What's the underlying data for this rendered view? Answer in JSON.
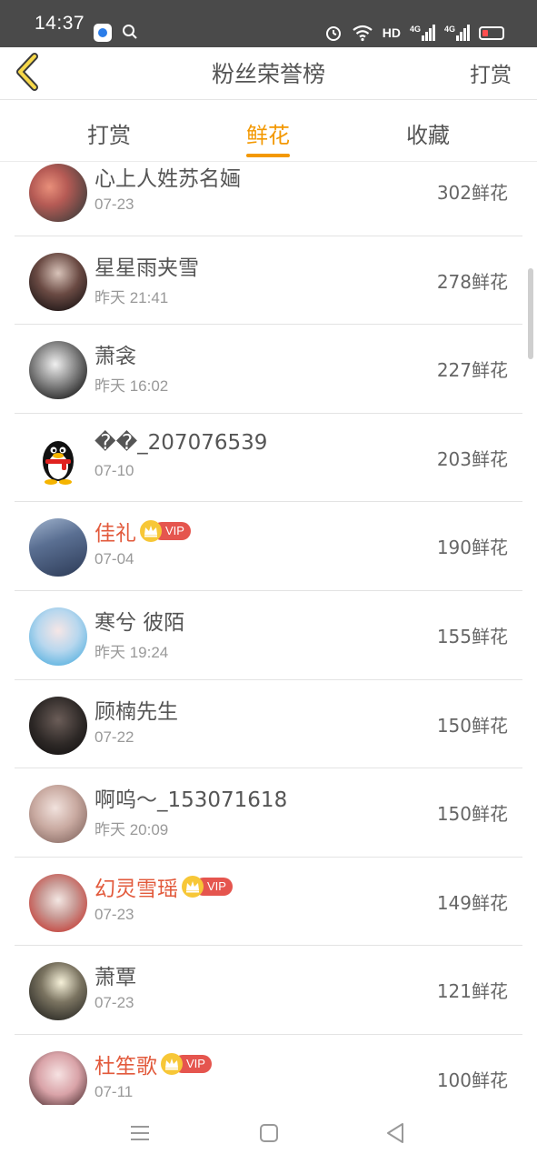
{
  "status_bar": {
    "time": "14:37",
    "network_label": "HD",
    "signal1_label": "4G",
    "signal2_label": "4G",
    "icons": [
      "app-icon",
      "search-icon",
      "alarm-icon",
      "wifi-icon",
      "signal-icon",
      "signal-icon",
      "battery-icon"
    ]
  },
  "header": {
    "title": "粉丝荣誉榜",
    "action_label": "打赏",
    "back_icon": "chevron-left-icon"
  },
  "tabs": [
    {
      "label": "打赏",
      "active": false
    },
    {
      "label": "鲜花",
      "active": true
    },
    {
      "label": "收藏",
      "active": false
    }
  ],
  "accent_color": "#f39800",
  "vip_name_color": "#e25a3c",
  "list": [
    {
      "name": "心上人姓苏名婳",
      "time": "07-23",
      "amount": "302鲜花",
      "vip": false,
      "vip_label": ""
    },
    {
      "name": "星星雨夹雪",
      "time": "昨天 21:41",
      "amount": "278鲜花",
      "vip": false,
      "vip_label": ""
    },
    {
      "name": "萧衾",
      "time": "昨天 16:02",
      "amount": "227鲜花",
      "vip": false,
      "vip_label": ""
    },
    {
      "name": "��_207076539",
      "time": "07-10",
      "amount": "203鲜花",
      "vip": false,
      "vip_label": ""
    },
    {
      "name": "佳礼",
      "time": "07-04",
      "amount": "190鲜花",
      "vip": true,
      "vip_label": "VIP"
    },
    {
      "name": "寒兮 彼陌",
      "time": "昨天 19:24",
      "amount": "155鲜花",
      "vip": false,
      "vip_label": ""
    },
    {
      "name": "顾楠先生",
      "time": "07-22",
      "amount": "150鲜花",
      "vip": false,
      "vip_label": ""
    },
    {
      "name": "啊呜～_153071618",
      "time": "昨天 20:09",
      "amount": "150鲜花",
      "vip": false,
      "vip_label": ""
    },
    {
      "name": "幻灵雪瑶",
      "time": "07-23",
      "amount": "149鲜花",
      "vip": true,
      "vip_label": "VIP"
    },
    {
      "name": "萧覃",
      "time": "07-23",
      "amount": "121鲜花",
      "vip": false,
      "vip_label": ""
    },
    {
      "name": "杜笙歌",
      "time": "07-11",
      "amount": "100鲜花",
      "vip": true,
      "vip_label": "VIP"
    }
  ],
  "nav_bar": {
    "icons": [
      "menu-icon",
      "home-icon",
      "back-triangle-icon"
    ]
  }
}
